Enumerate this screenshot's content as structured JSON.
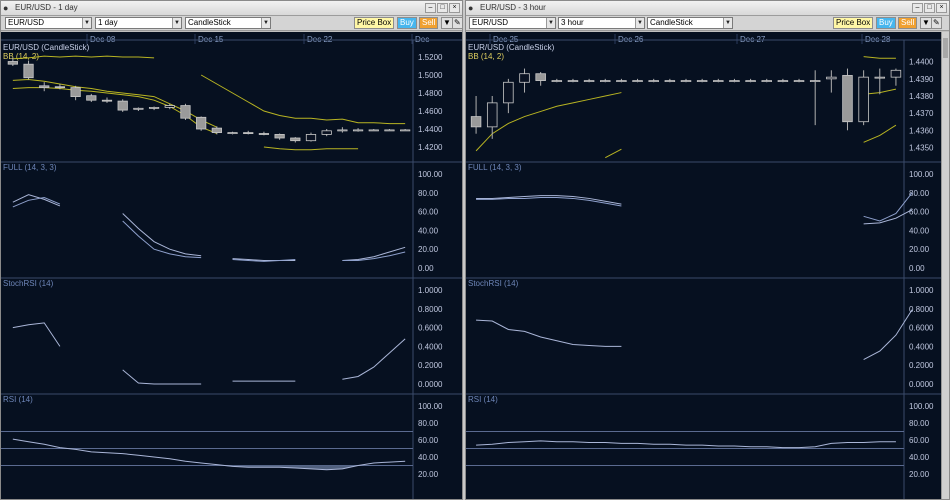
{
  "left": {
    "window_title": "EUR/USD - 1 day",
    "symbol": "EUR/USD",
    "timeframe": "1 day",
    "chart_type": "CandleStick",
    "price_box": "Price Box",
    "buy": "Buy",
    "sell": "Sell",
    "dates": [
      "Dec 08",
      "Dec 15",
      "Dec 22",
      "Dec"
    ],
    "panels": {
      "price": {
        "title": "EUR/USD (CandleStick)",
        "subtitle": "BB (14, 2)",
        "ticks": [
          "1.5200",
          "1.5000",
          "1.4800",
          "1.4600",
          "1.4400",
          "1.4200"
        ]
      },
      "full": {
        "title": "FULL (14, 3, 3)",
        "ticks": [
          "100.00",
          "80.00",
          "60.00",
          "40.00",
          "20.00",
          "0.00"
        ]
      },
      "stochrsi": {
        "title": "StochRSI (14)",
        "ticks": [
          "1.0000",
          "0.8000",
          "0.6000",
          "0.4000",
          "0.2000",
          "0.0000"
        ]
      },
      "rsi": {
        "title": "RSI (14)",
        "ticks": [
          "100.00",
          "80.00",
          "60.00",
          "40.00",
          "20.00"
        ]
      }
    }
  },
  "right": {
    "window_title": "EUR/USD - 3 hour",
    "symbol": "EUR/USD",
    "timeframe": "3 hour",
    "chart_type": "CandleStick",
    "price_box": "Price Box",
    "buy": "Buy",
    "sell": "Sell",
    "dates": [
      "Dec 25",
      "Dec 26",
      "Dec 27",
      "Dec 28"
    ],
    "panels": {
      "price": {
        "title": "EUR/USD (CandleStick)",
        "subtitle": "BB (14, 2)",
        "ticks": [
          "1.4400",
          "1.4390",
          "1.4380",
          "1.4370",
          "1.4360",
          "1.4350"
        ]
      },
      "full": {
        "title": "FULL (14, 3, 3)",
        "ticks": [
          "100.00",
          "80.00",
          "60.00",
          "40.00",
          "20.00",
          "0.00"
        ]
      },
      "stochrsi": {
        "title": "StochRSI (14)",
        "ticks": [
          "1.0000",
          "0.8000",
          "0.6000",
          "0.4000",
          "0.2000",
          "0.0000"
        ]
      },
      "rsi": {
        "title": "RSI (14)",
        "ticks": [
          "100.00",
          "80.00",
          "60.00",
          "40.00",
          "20.00"
        ]
      }
    }
  },
  "colors": {
    "background": "#061020",
    "label": "#6e86b8",
    "bollinger": "#b8b422",
    "indicator": "#aab6d8",
    "grid": "#2a3a5c",
    "up": "#0a1222",
    "down": "#9a9a9a",
    "rsi_band": "#5a6a90"
  },
  "icons": {
    "title": "window-icon",
    "minimize": "minimize-icon",
    "maximize": "maximize-icon",
    "close": "close-icon",
    "dropdown": "chevron-down-icon",
    "lock": "lock-icon"
  },
  "chart_data": [
    {
      "type": "candlestick",
      "title": "EUR/USD (CandleStick)",
      "timeframe": "1 day",
      "x_tick_labels": [
        "Dec 08",
        "Dec 15",
        "Dec 22",
        "Dec"
      ],
      "ylim": [
        1.41,
        1.53
      ],
      "ohlc": [
        [
          1.515,
          1.519,
          1.51,
          1.512
        ],
        [
          1.512,
          1.516,
          1.495,
          1.497
        ],
        [
          1.488,
          1.492,
          1.482,
          1.486
        ],
        [
          1.487,
          1.49,
          1.484,
          1.486
        ],
        [
          1.486,
          1.488,
          1.472,
          1.476
        ],
        [
          1.477,
          1.479,
          1.47,
          1.472
        ],
        [
          1.472,
          1.475,
          1.469,
          1.471
        ],
        [
          1.471,
          1.473,
          1.459,
          1.461
        ],
        [
          1.462,
          1.464,
          1.46,
          1.463
        ],
        [
          1.463,
          1.465,
          1.461,
          1.464
        ],
        [
          1.464,
          1.468,
          1.462,
          1.466
        ],
        [
          1.466,
          1.468,
          1.45,
          1.452
        ],
        [
          1.453,
          1.454,
          1.438,
          1.44
        ],
        [
          1.441,
          1.443,
          1.434,
          1.436
        ],
        [
          1.436,
          1.437,
          1.434,
          1.436
        ],
        [
          1.436,
          1.438,
          1.434,
          1.435
        ],
        [
          1.435,
          1.437,
          1.433,
          1.4345
        ],
        [
          1.434,
          1.435,
          1.428,
          1.43
        ],
        [
          1.43,
          1.431,
          1.425,
          1.427
        ],
        [
          1.427,
          1.436,
          1.426,
          1.434
        ],
        [
          1.434,
          1.44,
          1.432,
          1.438
        ],
        [
          1.438,
          1.442,
          1.436,
          1.439
        ],
        [
          1.439,
          1.441,
          1.437,
          1.439
        ],
        [
          1.439,
          1.44,
          1.438,
          1.439
        ],
        [
          1.439,
          1.44,
          1.438,
          1.439
        ],
        [
          1.439,
          1.44,
          1.438,
          1.439
        ]
      ],
      "bollinger": {
        "name": "BB (14, 2)",
        "upper": [
          1.518,
          1.519,
          1.521,
          1.52,
          1.521,
          1.52,
          1.521,
          1.52,
          1.52,
          1.519,
          null,
          null,
          1.5,
          1.49,
          1.48,
          1.47,
          1.46,
          1.455,
          1.452,
          1.452,
          1.45,
          1.451,
          1.447,
          1.447,
          1.446,
          1.446
        ],
        "middle": [
          1.494,
          1.495,
          1.493,
          1.49,
          1.487,
          1.485,
          1.482,
          1.48,
          1.478,
          1.476,
          1.468,
          1.46,
          1.45,
          1.442,
          null,
          null,
          null,
          null,
          null,
          null,
          null,
          null,
          null,
          null,
          null,
          null
        ],
        "lower": [
          1.485,
          1.486,
          1.486,
          1.485,
          1.483,
          1.482,
          1.48,
          1.478,
          1.476,
          1.472,
          1.465,
          1.455,
          1.442,
          1.435,
          null,
          null,
          1.42,
          1.418,
          1.417,
          1.417,
          1.418,
          1.418,
          1.418,
          null,
          null,
          null
        ]
      }
    },
    {
      "type": "line",
      "title": "FULL (14, 3, 3)",
      "timeframe": "1 day",
      "ylim": [
        0,
        100
      ],
      "series": [
        {
          "values": [
            70,
            78,
            73,
            66,
            null,
            null,
            null,
            58,
            42,
            28,
            20,
            15,
            13,
            null,
            10,
            9,
            8,
            8,
            8,
            null,
            null,
            8,
            9,
            12,
            17,
            22
          ]
        },
        {
          "values": [
            65,
            72,
            75,
            68,
            null,
            null,
            null,
            50,
            34,
            20,
            15,
            12,
            11,
            null,
            9,
            8,
            7,
            8,
            9,
            null,
            null,
            8,
            8,
            10,
            13,
            17
          ]
        }
      ]
    },
    {
      "type": "line",
      "title": "StochRSI (14)",
      "timeframe": "1 day",
      "ylim": [
        0,
        1
      ],
      "series": [
        {
          "values": [
            0.6,
            0.63,
            0.65,
            0.4,
            null,
            null,
            null,
            0.15,
            0.01,
            0.0,
            0.0,
            0.0,
            0.0,
            null,
            0.03,
            0.03,
            0.03,
            0.03,
            0.03,
            null,
            null,
            0.05,
            0.08,
            0.18,
            0.33,
            0.48
          ]
        }
      ]
    },
    {
      "type": "area",
      "title": "RSI (14)",
      "timeframe": "1 day",
      "ylim": [
        0,
        100
      ],
      "reference_lines": [
        70,
        50,
        30
      ],
      "series": [
        {
          "values": [
            61,
            58,
            55,
            51,
            49,
            46,
            45,
            44,
            42,
            40,
            38,
            35,
            33,
            31,
            29,
            28,
            28,
            28,
            27,
            26,
            25,
            26,
            30,
            33,
            34,
            35
          ]
        }
      ]
    },
    {
      "type": "candlestick",
      "title": "EUR/USD (CandleStick)",
      "timeframe": "3 hour",
      "x_tick_labels": [
        "Dec 25",
        "Dec 26",
        "Dec 27",
        "Dec 28"
      ],
      "ylim": [
        1.4345,
        1.4408
      ],
      "ohlc": [
        [
          1.4368,
          1.438,
          1.4358,
          1.4362
        ],
        [
          1.4362,
          1.438,
          1.4355,
          1.4376
        ],
        [
          1.4376,
          1.439,
          1.437,
          1.4388
        ],
        [
          1.4388,
          1.4396,
          1.4382,
          1.4393
        ],
        [
          1.4393,
          1.4394,
          1.4386,
          1.4389
        ],
        [
          1.4389,
          1.439,
          1.4388,
          1.4389
        ],
        [
          1.4389,
          1.439,
          1.4388,
          1.4389
        ],
        [
          1.4389,
          1.439,
          1.4388,
          1.4389
        ],
        [
          1.4389,
          1.439,
          1.4388,
          1.4389
        ],
        [
          1.4389,
          1.439,
          1.4388,
          1.4389
        ],
        [
          1.4389,
          1.439,
          1.4388,
          1.4389
        ],
        [
          1.4389,
          1.439,
          1.4388,
          1.4389
        ],
        [
          1.4389,
          1.439,
          1.4388,
          1.4389
        ],
        [
          1.4389,
          1.439,
          1.4388,
          1.4389
        ],
        [
          1.4389,
          1.439,
          1.4388,
          1.4389
        ],
        [
          1.4389,
          1.439,
          1.4388,
          1.4389
        ],
        [
          1.4389,
          1.439,
          1.4388,
          1.4389
        ],
        [
          1.4389,
          1.439,
          1.4388,
          1.4389
        ],
        [
          1.4389,
          1.439,
          1.4388,
          1.4389
        ],
        [
          1.4389,
          1.439,
          1.4388,
          1.4389
        ],
        [
          1.4389,
          1.439,
          1.4388,
          1.4389
        ],
        [
          1.4389,
          1.4395,
          1.4363,
          1.4389
        ],
        [
          1.439,
          1.4395,
          1.4382,
          1.4391
        ],
        [
          1.4392,
          1.4396,
          1.436,
          1.4365
        ],
        [
          1.4365,
          1.4395,
          1.4363,
          1.4391
        ],
        [
          1.4391,
          1.4396,
          1.4381,
          1.4391
        ],
        [
          1.4391,
          1.4396,
          1.4386,
          1.4395
        ]
      ],
      "bollinger": {
        "name": "BB (14, 2)",
        "upper": [
          null,
          null,
          null,
          null,
          null,
          null,
          null,
          null,
          null,
          null,
          null,
          null,
          null,
          null,
          null,
          null,
          null,
          null,
          null,
          null,
          null,
          null,
          null,
          null,
          1.4403,
          1.4402,
          1.4402
        ],
        "middle": [
          1.4348,
          1.4358,
          1.4364,
          1.4368,
          1.4371,
          1.4374,
          1.4376,
          1.4378,
          1.438,
          1.4382,
          null,
          null,
          null,
          null,
          null,
          null,
          null,
          null,
          null,
          null,
          null,
          null,
          null,
          null,
          1.4381,
          1.4382,
          1.4384
        ],
        "lower": [
          null,
          null,
          null,
          null,
          null,
          null,
          null,
          null,
          1.4344,
          1.4349,
          null,
          null,
          null,
          null,
          null,
          null,
          null,
          null,
          null,
          null,
          null,
          null,
          null,
          null,
          1.4353,
          1.4357,
          1.4363
        ]
      }
    },
    {
      "type": "line",
      "title": "FULL (14, 3, 3)",
      "timeframe": "3 hour",
      "ylim": [
        0,
        100
      ],
      "series": [
        {
          "values": [
            74,
            74,
            75,
            76,
            77,
            77,
            76,
            74,
            71,
            68,
            null,
            null,
            null,
            null,
            null,
            null,
            null,
            null,
            null,
            null,
            null,
            null,
            null,
            null,
            47,
            48,
            53,
            62
          ]
        },
        {
          "values": [
            73,
            73,
            74,
            74,
            75,
            75,
            74,
            72,
            69,
            66,
            null,
            null,
            null,
            null,
            null,
            null,
            null,
            null,
            null,
            null,
            null,
            null,
            null,
            null,
            55,
            50,
            58,
            80
          ]
        }
      ]
    },
    {
      "type": "line",
      "title": "StochRSI (14)",
      "timeframe": "3 hour",
      "ylim": [
        0,
        1
      ],
      "series": [
        {
          "values": [
            0.68,
            0.67,
            0.58,
            0.56,
            0.5,
            0.46,
            0.42,
            0.41,
            0.4,
            0.4,
            null,
            null,
            null,
            null,
            null,
            null,
            null,
            null,
            null,
            null,
            null,
            null,
            null,
            null,
            0.26,
            0.35,
            0.52,
            0.79
          ]
        }
      ]
    },
    {
      "type": "area",
      "title": "RSI (14)",
      "timeframe": "3 hour",
      "ylim": [
        0,
        100
      ],
      "reference_lines": [
        70,
        50,
        30
      ],
      "series": [
        {
          "values": [
            54,
            55,
            57,
            58,
            59,
            58,
            58,
            57,
            57,
            56,
            56,
            55,
            55,
            54,
            54,
            53,
            53,
            52,
            52,
            51,
            51,
            52,
            56,
            57,
            57,
            58,
            58
          ]
        }
      ]
    }
  ]
}
